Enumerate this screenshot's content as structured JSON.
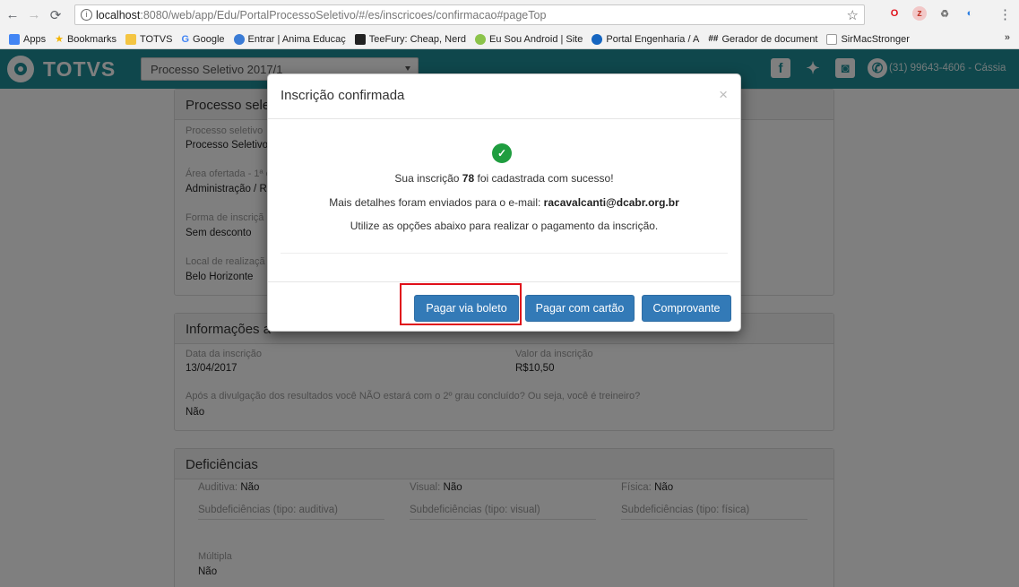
{
  "browser": {
    "url_host": "localhost",
    "url_path": ":8080/web/app/Edu/PortalProcessoSeletivo/#/es/inscricoes/confirmacao#pageTop",
    "bookmarks": [
      {
        "label": "Apps",
        "color": "#4285f4"
      },
      {
        "label": "Bookmarks",
        "color": "#f4b400"
      },
      {
        "label": "TOTVS",
        "color": "#f4c542"
      },
      {
        "label": "Google",
        "color": "#4285f4"
      },
      {
        "label": "Entrar | Anima Educaç",
        "color": "#3a7bd5"
      },
      {
        "label": "TeeFury: Cheap, Nerd",
        "color": "#222222"
      },
      {
        "label": "Eu Sou Android | Site",
        "color": "#8bc34a"
      },
      {
        "label": "Portal Engenharia / A",
        "color": "#1565c0"
      },
      {
        "label": "Gerador de document",
        "color": "#444444"
      },
      {
        "label": "SirMacStronger",
        "color": "#dddddd"
      }
    ],
    "more": "»"
  },
  "header": {
    "logo": "TOTVS",
    "process_select": "Processo Seletivo 2017/1",
    "phone": "(31) 99643-4606 - Cássia"
  },
  "panel1": {
    "title": "Processo sele",
    "fields": [
      {
        "label": "Processo seletivo",
        "value": "Processo Seletivo"
      },
      {
        "label": "Área ofertada - 1ª o",
        "value": "Administração / Re"
      },
      {
        "label": "Forma de inscriçã",
        "value": "Sem desconto"
      },
      {
        "label": "Local de realizaçã",
        "value": "Belo Horizonte"
      }
    ]
  },
  "panel2": {
    "title": "Informações a",
    "date_label": "Data da inscrição",
    "date_value": "13/04/2017",
    "fee_label": "Valor da inscrição",
    "fee_value": "R$10,50",
    "question_label": "Após a divulgação dos resultados você NÃO estará com o 2º grau concluído? Ou seja, você é treineiro?",
    "question_value": "Não"
  },
  "panel3": {
    "title": "Deficiências",
    "auditiva_label": "Auditiva:",
    "auditiva_value": "Não",
    "visual_label": "Visual:",
    "visual_value": "Não",
    "fisica_label": "Física:",
    "fisica_value": "Não",
    "sub_auditiva": "Subdeficiências (tipo: auditiva)",
    "sub_visual": "Subdeficiências (tipo: visual)",
    "sub_fisica": "Subdeficiências (tipo: física)",
    "multipla_label": "Múltipla",
    "multipla_value": "Não"
  },
  "modal": {
    "title": "Inscrição confirmada",
    "close": "×",
    "line1_pre": "Sua inscrição ",
    "line1_num": "78",
    "line1_post": " foi cadastrada com sucesso!",
    "line2_pre": "Mais detalhes foram enviados para o e-mail: ",
    "line2_email": "racavalcanti@dcabr.org.br",
    "line3": "Utilize as opções abaixo para realizar o pagamento da inscrição.",
    "btn_boleto": "Pagar via boleto",
    "btn_cartao": "Pagar com cartão",
    "btn_comprovante": "Comprovante"
  }
}
